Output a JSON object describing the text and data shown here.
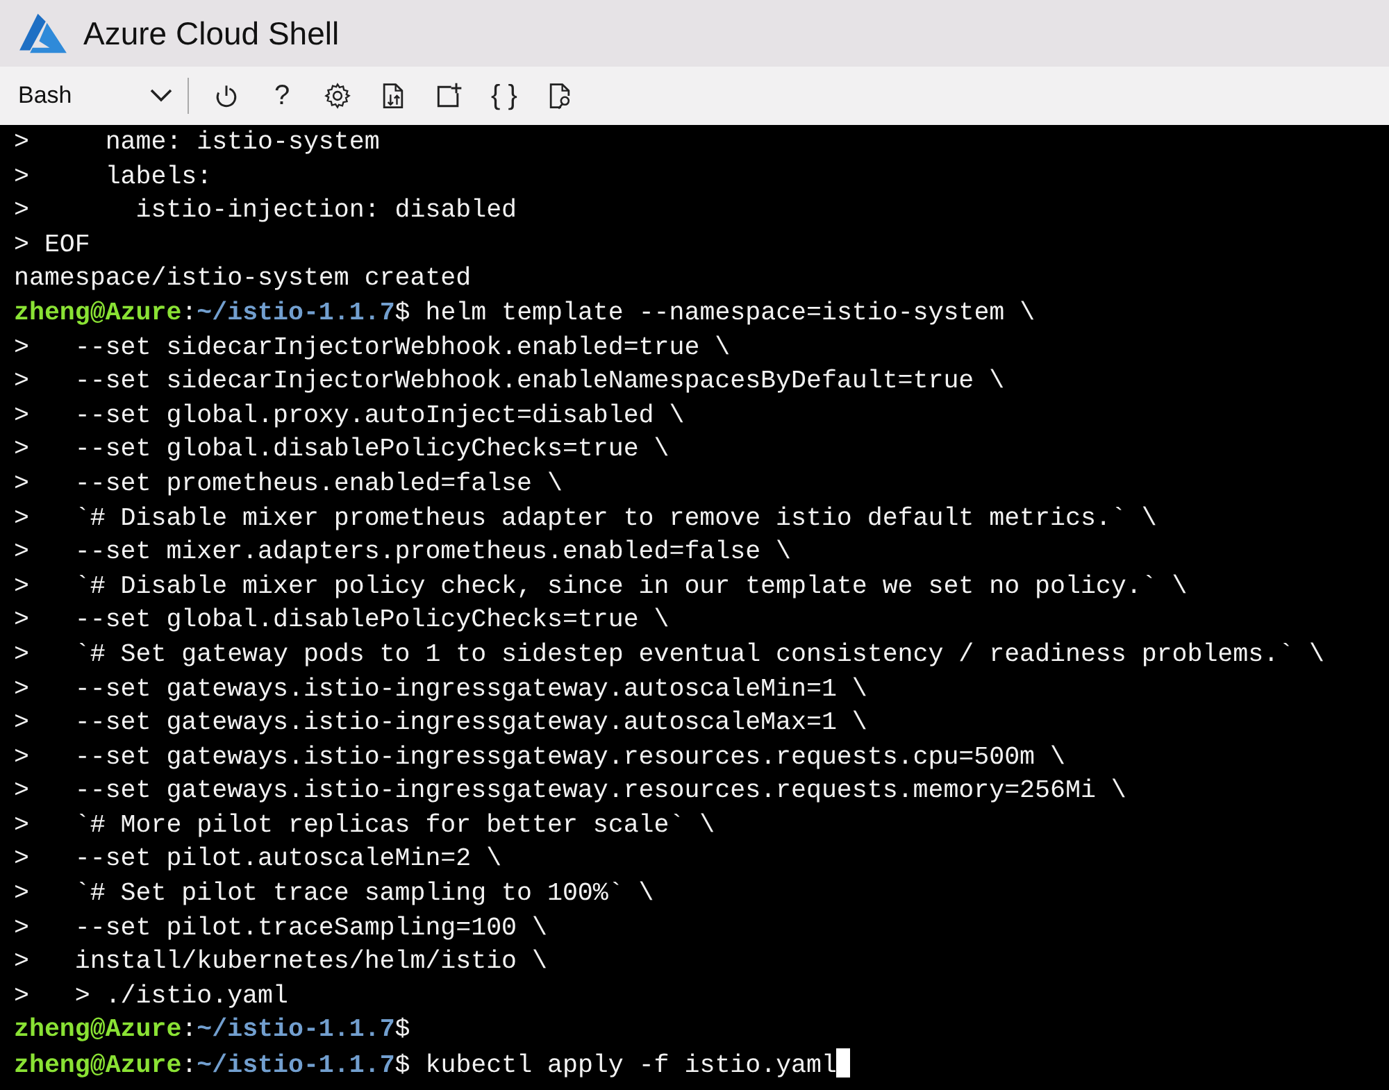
{
  "window": {
    "title": "Azure Cloud Shell"
  },
  "toolbar": {
    "shell": "Bash",
    "buttons": [
      {
        "kind": "power"
      },
      {
        "kind": "help",
        "label": "?"
      },
      {
        "kind": "settings"
      },
      {
        "kind": "upload"
      },
      {
        "kind": "new-session"
      },
      {
        "kind": "editor",
        "label": "{ }"
      },
      {
        "kind": "web-preview"
      }
    ]
  },
  "terminal": {
    "lines": [
      {
        "kind": "output",
        "text": ">     name: istio-system"
      },
      {
        "kind": "output",
        "text": ">     labels:"
      },
      {
        "kind": "output",
        "text": ">       istio-injection: disabled"
      },
      {
        "kind": "output",
        "text": "> EOF"
      },
      {
        "kind": "output",
        "text": "namespace/istio-system created"
      },
      {
        "kind": "prompt",
        "user": "zheng@Azure",
        "sep": ":",
        "path": "~/istio-1.1.7",
        "symbol": "$",
        "command": " helm template --namespace=istio-system \\",
        "cursor": false
      },
      {
        "kind": "output",
        "text": ">   --set sidecarInjectorWebhook.enabled=true \\"
      },
      {
        "kind": "output",
        "text": ">   --set sidecarInjectorWebhook.enableNamespacesByDefault=true \\"
      },
      {
        "kind": "output",
        "text": ">   --set global.proxy.autoInject=disabled \\"
      },
      {
        "kind": "output",
        "text": ">   --set global.disablePolicyChecks=true \\"
      },
      {
        "kind": "output",
        "text": ">   --set prometheus.enabled=false \\"
      },
      {
        "kind": "output",
        "text": ">   `# Disable mixer prometheus adapter to remove istio default metrics.` \\"
      },
      {
        "kind": "output",
        "text": ">   --set mixer.adapters.prometheus.enabled=false \\"
      },
      {
        "kind": "output",
        "text": ">   `# Disable mixer policy check, since in our template we set no policy.` \\"
      },
      {
        "kind": "output",
        "text": ">   --set global.disablePolicyChecks=true \\"
      },
      {
        "kind": "output",
        "text": ">   `# Set gateway pods to 1 to sidestep eventual consistency / readiness problems.` \\"
      },
      {
        "kind": "output",
        "text": ">   --set gateways.istio-ingressgateway.autoscaleMin=1 \\"
      },
      {
        "kind": "output",
        "text": ">   --set gateways.istio-ingressgateway.autoscaleMax=1 \\"
      },
      {
        "kind": "output",
        "text": ">   --set gateways.istio-ingressgateway.resources.requests.cpu=500m \\"
      },
      {
        "kind": "output",
        "text": ">   --set gateways.istio-ingressgateway.resources.requests.memory=256Mi \\"
      },
      {
        "kind": "output",
        "text": ">   `# More pilot replicas for better scale` \\"
      },
      {
        "kind": "output",
        "text": ">   --set pilot.autoscaleMin=2 \\"
      },
      {
        "kind": "output",
        "text": ">   `# Set pilot trace sampling to 100%` \\"
      },
      {
        "kind": "output",
        "text": ">   --set pilot.traceSampling=100 \\"
      },
      {
        "kind": "output",
        "text": ">   install/kubernetes/helm/istio \\"
      },
      {
        "kind": "output",
        "text": ">   > ./istio.yaml"
      },
      {
        "kind": "prompt",
        "user": "zheng@Azure",
        "sep": ":",
        "path": "~/istio-1.1.7",
        "symbol": "$",
        "cursor": false
      },
      {
        "kind": "prompt",
        "user": "zheng@Azure",
        "sep": ":",
        "path": "~/istio-1.1.7",
        "symbol": "$",
        "command": " kubectl apply -f istio.yaml",
        "cursor": true
      }
    ]
  }
}
